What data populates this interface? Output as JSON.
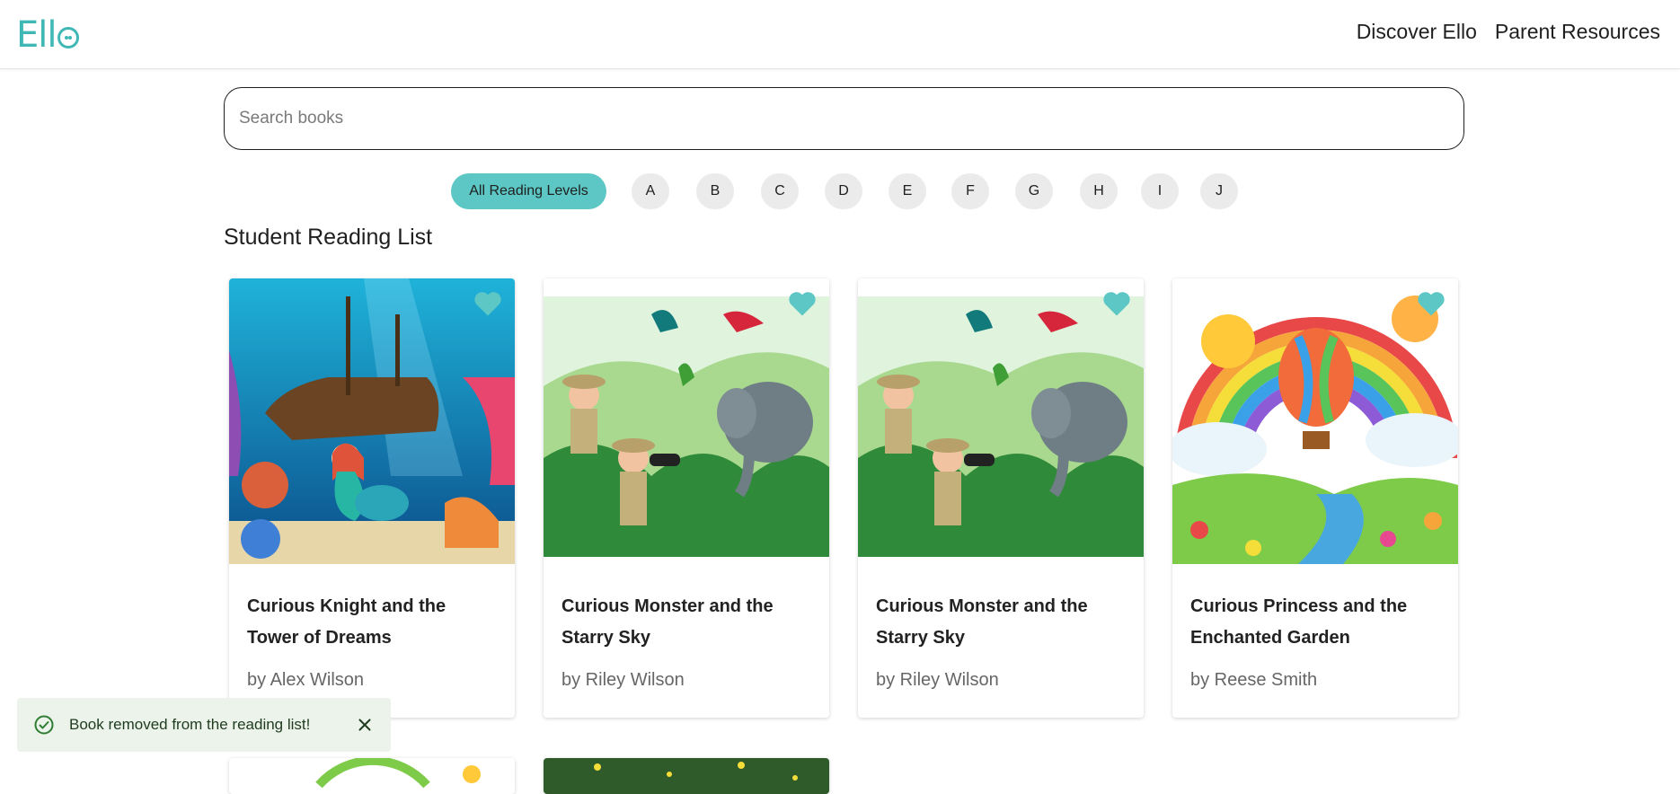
{
  "header": {
    "logo_text": "Ell",
    "nav": [
      "Discover Ello",
      "Parent Resources"
    ]
  },
  "search": {
    "placeholder": "Search books",
    "value": ""
  },
  "levels": {
    "active_label": "All Reading Levels",
    "letters": [
      "A",
      "B",
      "C",
      "D",
      "E",
      "F",
      "G",
      "H",
      "I",
      "J"
    ]
  },
  "section_title": "Student Reading List",
  "books": [
    {
      "title": "Curious Knight and the Tower of Dreams",
      "author": "by Alex Wilson",
      "cover": "underwater-shipwreck-mermaid"
    },
    {
      "title": "Curious Monster and the Starry Sky",
      "author": "by Riley Wilson",
      "cover": "jungle-explorers-elephant"
    },
    {
      "title": "Curious Monster and the Starry Sky",
      "author": "by Riley Wilson",
      "cover": "jungle-explorers-elephant"
    },
    {
      "title": "Curious Princess and the Enchanted Garden",
      "author": "by Reese Smith",
      "cover": "rainbow-hot-air-balloon"
    }
  ],
  "toast": {
    "message": "Book removed from the reading list!"
  },
  "colors": {
    "accent": "#5cc7c4",
    "logo": "#3fb8b5",
    "toast_bg": "#ebf3ea",
    "toast_icon": "#2e7d32"
  }
}
